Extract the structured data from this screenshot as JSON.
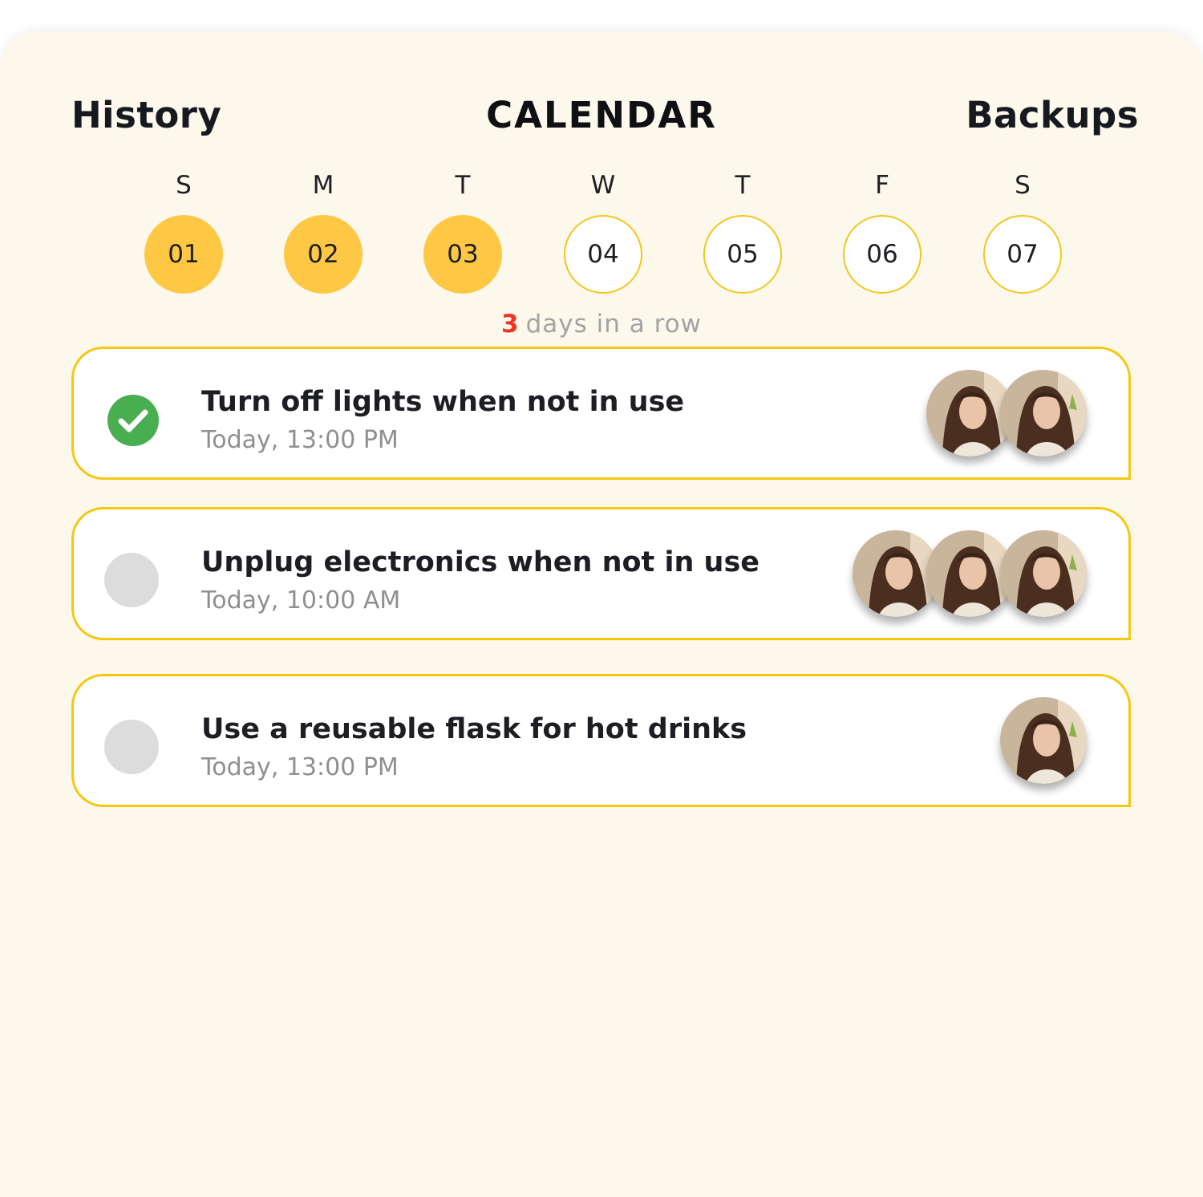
{
  "tabs": {
    "history": "History",
    "calendar": "CALENDAR",
    "backups": "Backups"
  },
  "week": {
    "days": [
      {
        "letter": "S",
        "date": "01",
        "done": true
      },
      {
        "letter": "M",
        "date": "02",
        "done": true
      },
      {
        "letter": "T",
        "date": "03",
        "done": true
      },
      {
        "letter": "W",
        "date": "04",
        "done": false
      },
      {
        "letter": "T",
        "date": "05",
        "done": false
      },
      {
        "letter": "F",
        "date": "06",
        "done": false
      },
      {
        "letter": "S",
        "date": "07",
        "done": false
      }
    ]
  },
  "streak": {
    "count": "3",
    "label": "days in a row"
  },
  "tasks": [
    {
      "title": "Turn off lights when not in use",
      "time": "Today, 13:00 PM",
      "completed": true,
      "participants": 2
    },
    {
      "title": "Unplug electronics when not in use",
      "time": "Today, 10:00 AM",
      "completed": false,
      "participants": 3
    },
    {
      "title": "Use a reusable flask for hot drinks",
      "time": "Today, 13:00 PM",
      "completed": false,
      "participants": 1
    }
  ],
  "colors": {
    "background": "#fcf8ec",
    "accent": "#f6c70f",
    "day_done": "#fec845",
    "check_green": "#49ae4f",
    "check_empty": "#dcdcdc",
    "streak_number": "#ef3526",
    "muted_text": "#8f8f8f"
  },
  "icons": {
    "check": "check-circle-icon",
    "avatar": "user-avatar"
  }
}
